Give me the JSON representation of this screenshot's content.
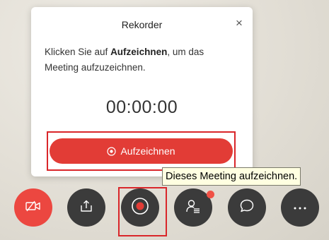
{
  "recorder": {
    "title": "Rekorder",
    "close_glyph": "×",
    "desc_prefix": "Klicken Sie auf ",
    "desc_bold": "Aufzeichnen",
    "desc_suffix": ", um das Meeting aufzuzeichnen.",
    "timer": "00:00:00",
    "record_button_label": "Aufzeichnen"
  },
  "tooltip": {
    "text": "Dieses Meeting aufzeichnen."
  },
  "toolbar": {
    "buttons": [
      {
        "icon": "video-off-icon",
        "color": "#ec4740"
      },
      {
        "icon": "share-upload-icon",
        "color": "#3b3b3b"
      },
      {
        "icon": "record-icon",
        "color": "#3b3b3b"
      },
      {
        "icon": "participants-icon",
        "color": "#3b3b3b",
        "badge_color": "#f05145"
      },
      {
        "icon": "chat-icon",
        "color": "#3b3b3b"
      },
      {
        "icon": "more-icon",
        "color": "#3b3b3b"
      }
    ]
  },
  "colors": {
    "accent": "#e23c36",
    "highlight": "#d9262a",
    "tooltip_bg": "#ffffe1"
  }
}
